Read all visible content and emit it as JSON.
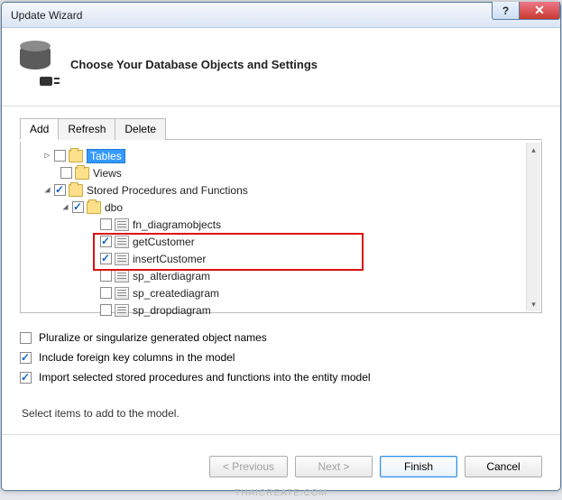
{
  "window": {
    "title": "Update Wizard"
  },
  "header": {
    "title": "Choose Your Database Objects and Settings"
  },
  "tabs": {
    "add": "Add",
    "refresh": "Refresh",
    "delete": "Delete"
  },
  "tree": {
    "tables": "Tables",
    "views": "Views",
    "sprocs": "Stored Procedures and Functions",
    "dbo": "dbo",
    "items": {
      "fn_diagramobjects": "fn_diagramobjects",
      "getCustomer": "getCustomer",
      "insertCustomer": "insertCustomer",
      "sp_alterdiagram": "sp_alterdiagram",
      "sp_creatediagram": "sp_creatediagram",
      "sp_dropdiagram": "sp_dropdiagram"
    }
  },
  "options": {
    "pluralize": "Pluralize or singularize generated object names",
    "fkcols": "Include foreign key columns in the model",
    "importprocs": "Import selected stored procedures and functions into the entity model"
  },
  "hint": "Select items to add to the model.",
  "buttons": {
    "previous": "< Previous",
    "next": "Next >",
    "finish": "Finish",
    "cancel": "Cancel"
  },
  "watermark": "THAICREATE.COM"
}
